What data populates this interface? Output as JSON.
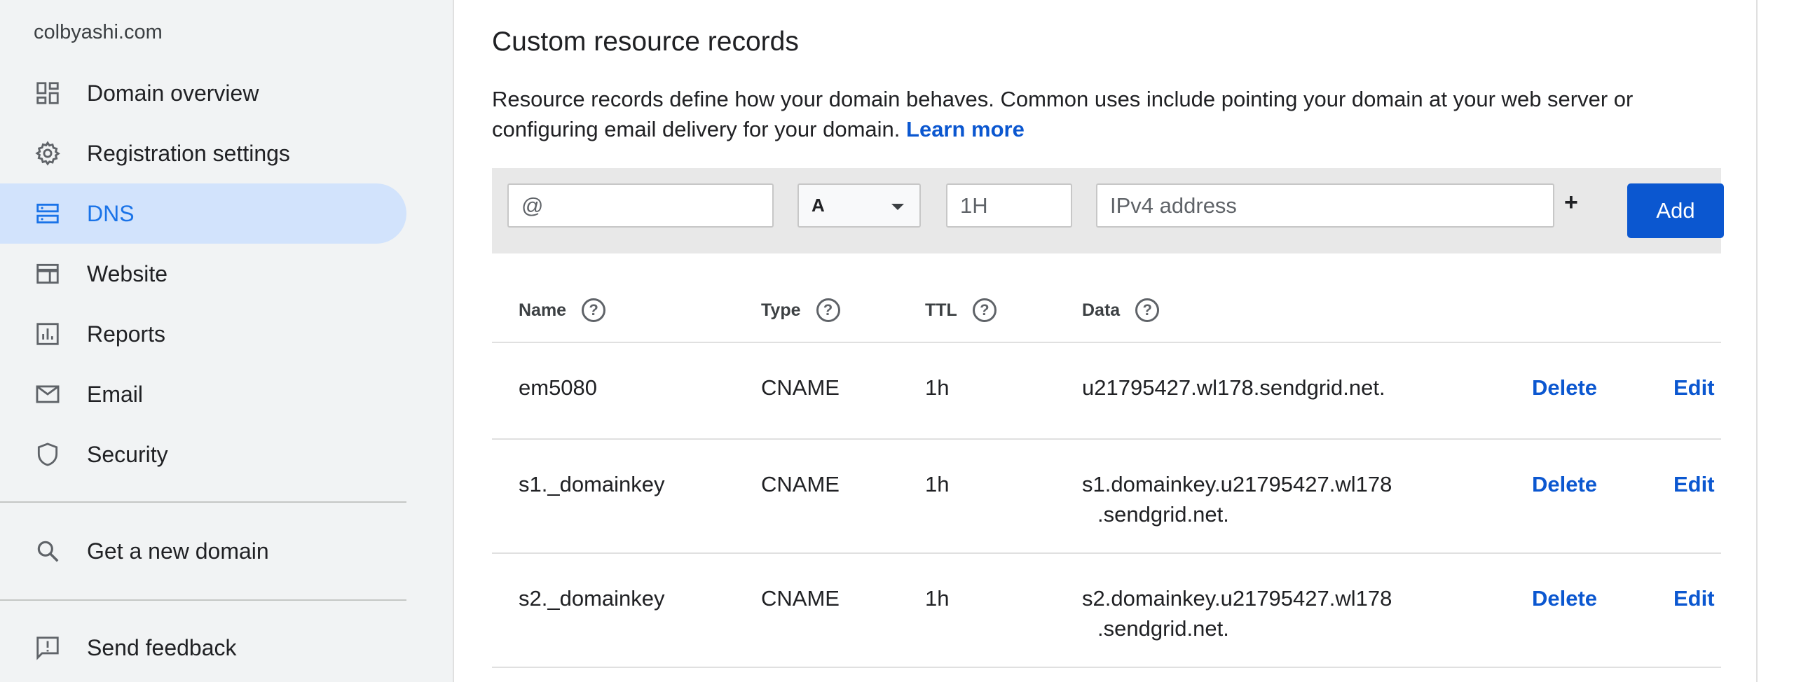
{
  "sidebar": {
    "domain": "colbyashi.com",
    "items": [
      {
        "label": "Domain overview",
        "icon": "dashboard-icon"
      },
      {
        "label": "Registration settings",
        "icon": "gear-icon"
      },
      {
        "label": "DNS",
        "icon": "dns-icon",
        "active": true
      },
      {
        "label": "Website",
        "icon": "website-icon"
      },
      {
        "label": "Reports",
        "icon": "reports-icon"
      },
      {
        "label": "Email",
        "icon": "mail-icon"
      },
      {
        "label": "Security",
        "icon": "shield-icon"
      }
    ],
    "get_domain": {
      "label": "Get a new domain",
      "icon": "search-icon"
    },
    "feedback": {
      "label": "Send feedback",
      "icon": "feedback-icon"
    }
  },
  "main": {
    "title": "Custom resource records",
    "description": "Resource records define how your domain behaves. Common uses include pointing your domain at your web server or configuring email delivery for your domain.",
    "learn_more": "Learn more",
    "add_form": {
      "name_placeholder": "@",
      "type_value": "A",
      "ttl_placeholder": "1H",
      "data_placeholder": "IPv4 address",
      "plus": "+",
      "add_label": "Add"
    },
    "table": {
      "headers": {
        "name": "Name",
        "type": "Type",
        "ttl": "TTL",
        "data": "Data",
        "help": "?"
      },
      "delete_label": "Delete",
      "edit_label": "Edit",
      "rows": [
        {
          "name": "em5080",
          "type": "CNAME",
          "ttl": "1h",
          "data_line1": "u21795427.wl178.sendgrid.net.",
          "data_line2": ""
        },
        {
          "name": "s1._domainkey",
          "type": "CNAME",
          "ttl": "1h",
          "data_line1": "s1.domainkey.u21795427.wl178",
          "data_line2": ".sendgrid.net."
        },
        {
          "name": "s2._domainkey",
          "type": "CNAME",
          "ttl": "1h",
          "data_line1": "s2.domainkey.u21795427.wl178",
          "data_line2": ".sendgrid.net."
        }
      ]
    }
  },
  "colors": {
    "accent": "#0b57d0",
    "active_bg": "#d2e3fc",
    "sidebar_bg": "#f1f3f4"
  }
}
